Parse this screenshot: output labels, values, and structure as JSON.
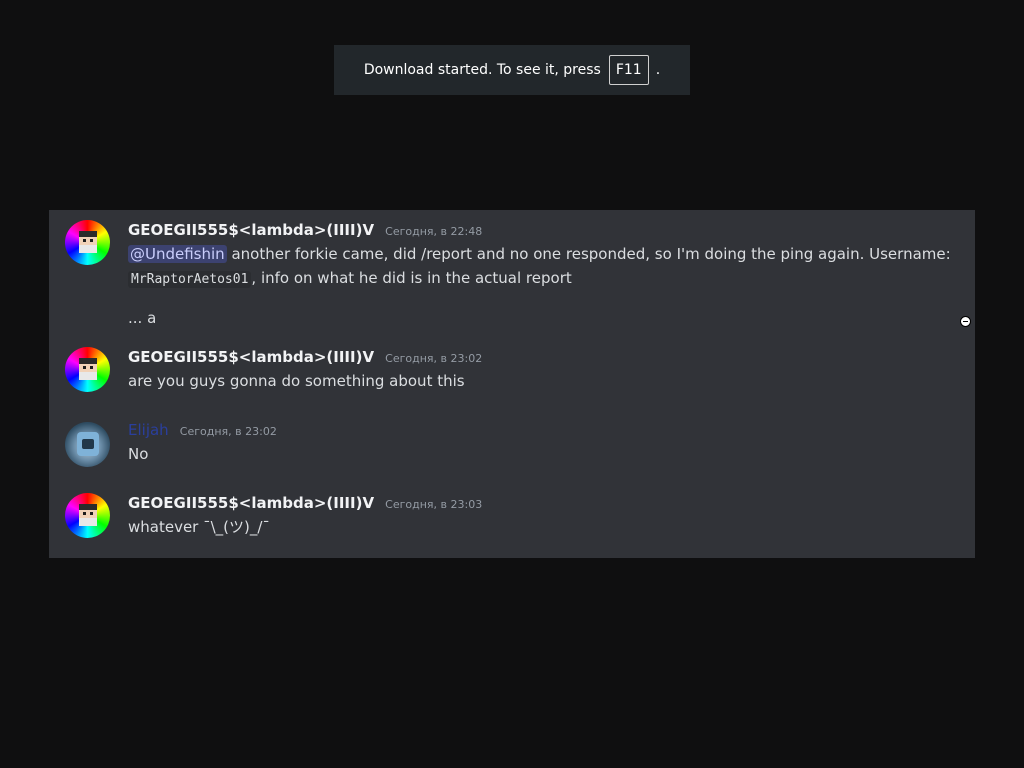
{
  "toast": {
    "text": "Download started. To see it, press",
    "key": "F11",
    "suffix": "."
  },
  "messages": [
    {
      "username": "GEOEGII555$<lambda>(IIII)V",
      "timestamp": "Сегодня, в 22:48",
      "mention": "@Undefishin",
      "text_part1": " another forkie came, did /report and no one responded, so I'm doing the ping again. Username:",
      "code": "MrRaptorAetos01",
      "text_part2": ", info on what he did is in the actual report",
      "followup": "... a"
    },
    {
      "username": "GEOEGII555$<lambda>(IIII)V",
      "timestamp": "Сегодня, в 23:02",
      "text": "are you guys gonna do something about this"
    },
    {
      "username": "Elijah",
      "timestamp": "Сегодня, в 23:02",
      "text": "No"
    },
    {
      "username": "GEOEGII555$<lambda>(IIII)V",
      "timestamp": "Сегодня, в 23:03",
      "text": "whatever ¯\\_(ツ)_/¯"
    }
  ],
  "colors": {
    "background": "#0f0f10",
    "panel": "#313338",
    "mention_bg": "#3c4270",
    "elijah_name": "#2a3f9d"
  }
}
